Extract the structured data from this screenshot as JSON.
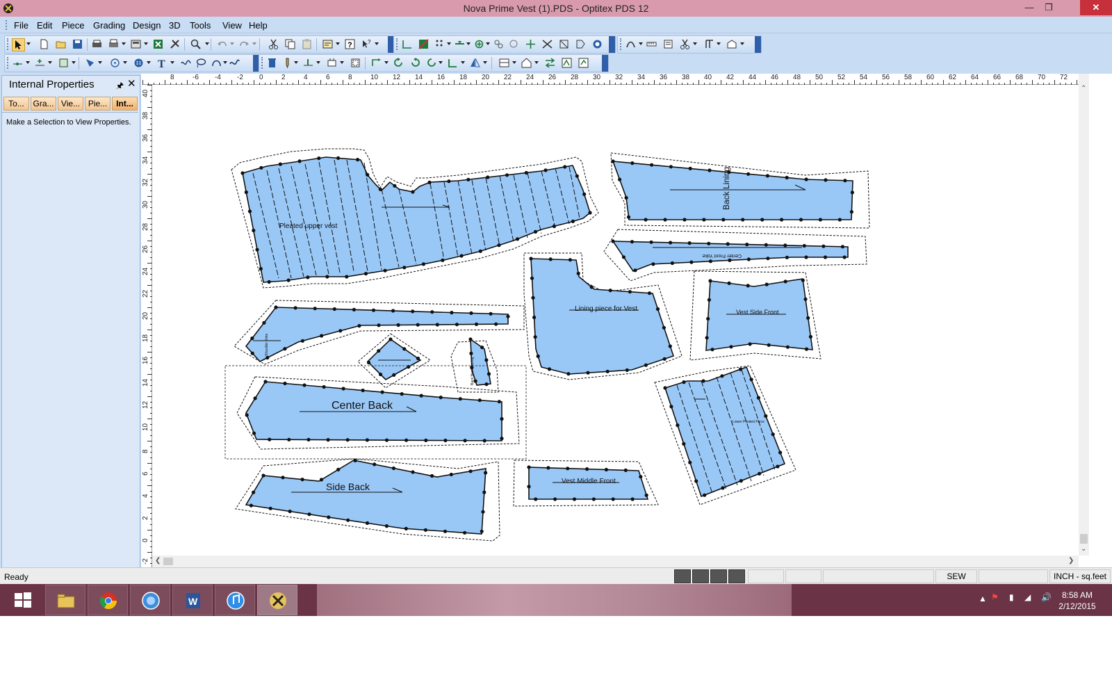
{
  "window": {
    "title": "Nova Prime Vest (1).PDS - Optitex PDS 12"
  },
  "menu": [
    "File",
    "Edit",
    "Piece",
    "Grading",
    "Design",
    "3D",
    "Tools",
    "View",
    "Help"
  ],
  "panel": {
    "title": "Internal Properties",
    "tabs": [
      "To...",
      "Gra...",
      "Vie...",
      "Pie...",
      "Int..."
    ],
    "active_tab": "Int...",
    "message": "Make a Selection to View Properties."
  },
  "ruler": {
    "h_labels": [
      "8",
      "-6",
      "-4",
      "-2",
      "0",
      "2",
      "4",
      "6",
      "8",
      "10",
      "12",
      "14",
      "16",
      "18",
      "20",
      "22",
      "24",
      "26",
      "28",
      "30",
      "32",
      "34",
      "36",
      "38",
      "40",
      "42",
      "44",
      "46",
      "48",
      "50",
      "52",
      "54",
      "56",
      "58",
      "60",
      "62",
      "64",
      "66",
      "68",
      "70",
      "72"
    ],
    "v_labels": [
      "40",
      "38",
      "36",
      "34",
      "32",
      "30",
      "28",
      "26",
      "24",
      "22",
      "20",
      "18",
      "16",
      "14",
      "12",
      "10",
      "8",
      "6",
      "4",
      "2",
      "0",
      "-2"
    ]
  },
  "pieces": {
    "pleated_upper_vest": "Pleated upper vest",
    "back_lining": "Back Lining",
    "center_front_yoke": "Center Front Yoke",
    "lining_piece": "Lining piece for Vest",
    "vest_side_front": "Vest Side Front",
    "center_back": "Center Back",
    "side_back": "Side Back",
    "vest_middle_front": "Vest Middle Front"
  },
  "statusbar": {
    "status": "Ready",
    "mode": "SEW",
    "units": "INCH - sq.feet"
  },
  "taskbar": {
    "time": "8:58 AM",
    "date": "2/12/2015"
  },
  "colors": {
    "piece_fill": "#99c8f7",
    "titlebar": "#d99aae",
    "menubar": "#c8dcf4",
    "taskbar": "#6a3446"
  }
}
